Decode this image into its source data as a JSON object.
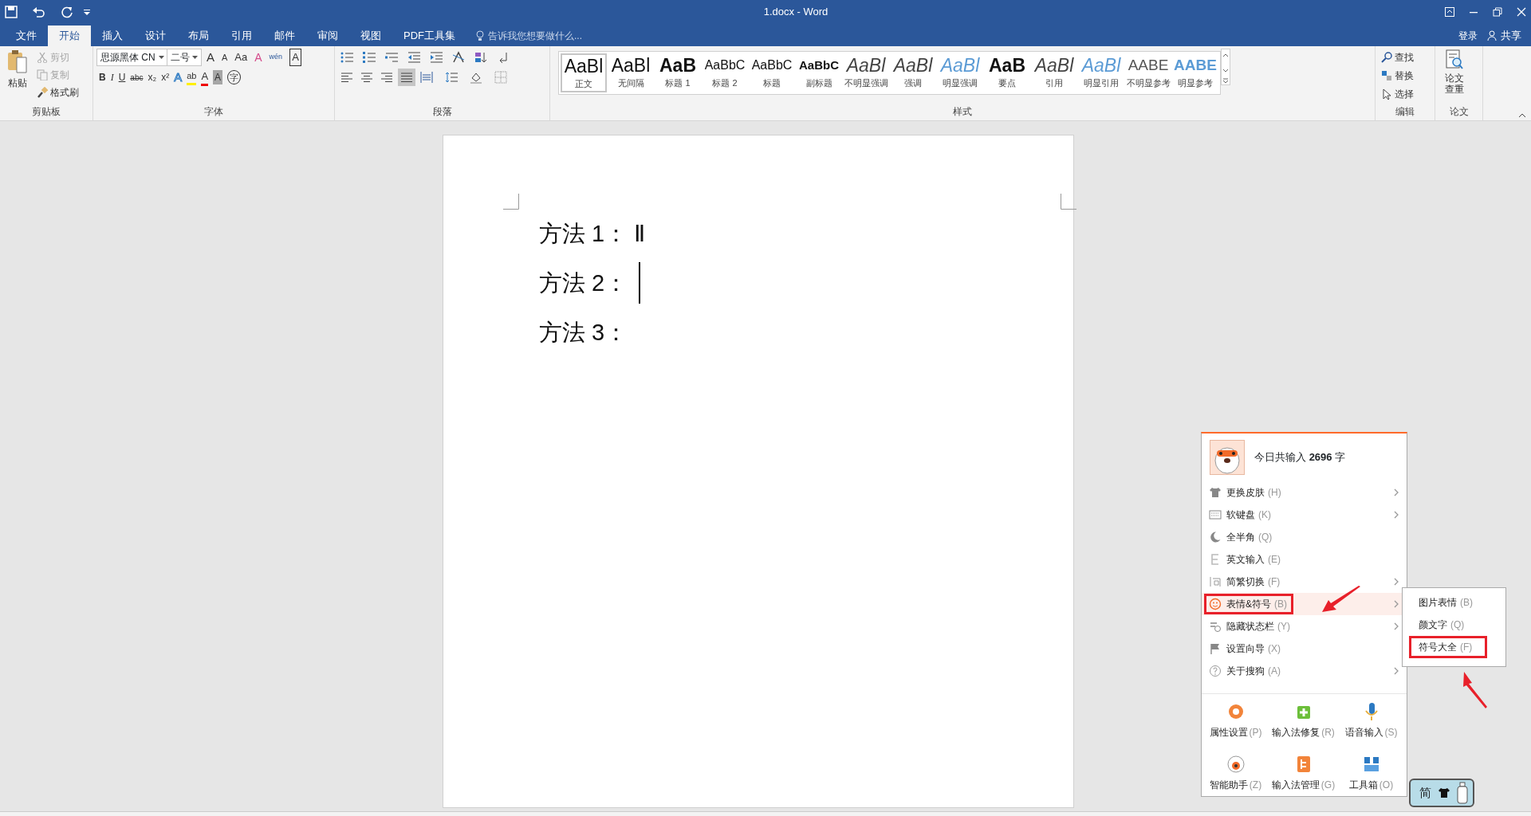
{
  "window": {
    "title": "1.docx - Word"
  },
  "account": {
    "sign_in": "登录",
    "share": "共享"
  },
  "tabs": [
    {
      "label": "文件",
      "selected": false
    },
    {
      "label": "开始",
      "selected": true
    },
    {
      "label": "插入",
      "selected": false
    },
    {
      "label": "设计",
      "selected": false
    },
    {
      "label": "布局",
      "selected": false
    },
    {
      "label": "引用",
      "selected": false
    },
    {
      "label": "邮件",
      "selected": false
    },
    {
      "label": "审阅",
      "selected": false
    },
    {
      "label": "视图",
      "selected": false
    },
    {
      "label": "PDF工具集",
      "selected": false
    }
  ],
  "tell_me": {
    "placeholder": "告诉我您想要做什么..."
  },
  "clipboard": {
    "label": "剪贴板",
    "paste": "粘贴",
    "items": [
      {
        "label": "剪切",
        "kind": "cut",
        "disabled": true
      },
      {
        "label": "复制",
        "kind": "copy",
        "disabled": true
      },
      {
        "label": "格式刷",
        "kind": "painter",
        "disabled": false
      }
    ]
  },
  "font": {
    "label": "字体",
    "font_name": "思源黑体 CN",
    "font_size": "二号",
    "row1": [
      {
        "glyph": "A",
        "kind": "grow"
      },
      {
        "glyph": "A",
        "kind": "shrink"
      },
      {
        "glyph": "Aa",
        "kind": "case"
      },
      {
        "glyph": "A",
        "kind": "clear"
      },
      {
        "glyph": "wén",
        "kind": "phonetic"
      },
      {
        "glyph": "A",
        "kind": "border"
      }
    ],
    "row2": [
      {
        "glyph": "B",
        "kind": "bold"
      },
      {
        "glyph": "I",
        "kind": "italic"
      },
      {
        "glyph": "U",
        "kind": "underline"
      },
      {
        "glyph": "abc",
        "kind": "strike"
      },
      {
        "glyph": "x₂",
        "kind": "sub"
      },
      {
        "glyph": "x²",
        "kind": "sup"
      },
      {
        "glyph": "A",
        "kind": "effect"
      },
      {
        "glyph": "ab",
        "kind": "highlight"
      },
      {
        "glyph": "A",
        "kind": "color"
      },
      {
        "glyph": "A",
        "kind": "shade"
      },
      {
        "glyph": "字",
        "kind": "enclose"
      }
    ]
  },
  "paragraph": {
    "label": "段落",
    "alignment": [
      {
        "kind": "left",
        "selected": false
      },
      {
        "kind": "center",
        "selected": false
      },
      {
        "kind": "right",
        "selected": false
      },
      {
        "kind": "justify",
        "selected": true
      },
      {
        "kind": "distributed",
        "selected": false
      }
    ]
  },
  "styles": {
    "label": "样式",
    "items": [
      {
        "preview": "AaBl",
        "name": "正文",
        "selected": true
      },
      {
        "preview": "AaBl",
        "name": "无间隔",
        "selected": false
      },
      {
        "preview": "AaB",
        "name": "标题 1",
        "selected": false
      },
      {
        "preview": "AaBbC",
        "name": "标题 2",
        "selected": false
      },
      {
        "preview": "AaBbC",
        "name": "标题",
        "selected": false
      },
      {
        "preview": "AaBbC",
        "name": "副标题",
        "selected": false
      },
      {
        "preview": "AaBl",
        "name": "不明显强调",
        "selected": false
      },
      {
        "preview": "AaBl",
        "name": "强调",
        "selected": false
      },
      {
        "preview": "AaBl",
        "name": "明显强调",
        "selected": false
      },
      {
        "preview": "AaB",
        "name": "要点",
        "selected": false
      },
      {
        "preview": "AaBl",
        "name": "引用",
        "selected": false
      },
      {
        "preview": "AaBl",
        "name": "明显引用",
        "selected": false
      },
      {
        "preview": "AABE",
        "name": "不明显参考",
        "selected": false
      },
      {
        "preview": "AABE",
        "name": "明显参考",
        "selected": false
      }
    ]
  },
  "editing": {
    "label": "编辑",
    "items": [
      {
        "label": "查找",
        "kind": "find"
      },
      {
        "label": "替换",
        "kind": "replace"
      },
      {
        "label": "选择",
        "kind": "select"
      }
    ]
  },
  "paper": {
    "label": "论文",
    "button": "论文查重"
  },
  "document": {
    "lines": [
      {
        "text": "方法 1： Ⅱ",
        "cursor": false
      },
      {
        "text": "方法 2：",
        "cursor": true
      },
      {
        "text": "方法 3：",
        "cursor": false
      }
    ]
  },
  "ime_menu": {
    "summary": "今日共输入 **2696** 字",
    "items": [
      {
        "label": "更换皮肤",
        "shortcut": "(H)",
        "submenu": true,
        "selected": false,
        "highlighted": false
      },
      {
        "label": "软键盘",
        "shortcut": "(K)",
        "submenu": true,
        "selected": false,
        "highlighted": false
      },
      {
        "label": "全半角",
        "shortcut": "(Q)",
        "submenu": false,
        "selected": false,
        "highlighted": false
      },
      {
        "label": "英文输入",
        "shortcut": "(E)",
        "submenu": false,
        "selected": false,
        "highlighted": false
      },
      {
        "label": "简繁切换",
        "shortcut": "(F)",
        "submenu": true,
        "selected": false,
        "highlighted": false
      },
      {
        "label": "表情&符号",
        "shortcut": "(B)",
        "submenu": true,
        "selected": true,
        "highlighted": true
      },
      {
        "label": "隐藏状态栏",
        "shortcut": "(Y)",
        "submenu": true,
        "selected": false,
        "highlighted": false
      },
      {
        "label": "设置向导",
        "shortcut": "(X)",
        "submenu": false,
        "selected": false,
        "highlighted": false
      },
      {
        "label": "关于搜狗",
        "shortcut": "(A)",
        "submenu": true,
        "selected": false,
        "highlighted": false
      }
    ],
    "submenu": [
      {
        "label": "图片表情",
        "shortcut": "(B)",
        "highlighted": false
      },
      {
        "label": "颜文字",
        "shortcut": "(Q)",
        "highlighted": false
      },
      {
        "label": "符号大全",
        "shortcut": "(F)",
        "highlighted": true
      }
    ],
    "tools": [
      {
        "label": "属性设置",
        "shortcut": "(P)"
      },
      {
        "label": "输入法修复",
        "shortcut": "(R)"
      },
      {
        "label": "语音输入",
        "shortcut": "(S)"
      },
      {
        "label": "智能助手",
        "shortcut": "(Z)"
      },
      {
        "label": "输入法管理",
        "shortcut": "(G)"
      },
      {
        "label": "工具箱",
        "shortcut": "(O)"
      }
    ]
  },
  "ime_bar": {
    "mode": "简"
  }
}
